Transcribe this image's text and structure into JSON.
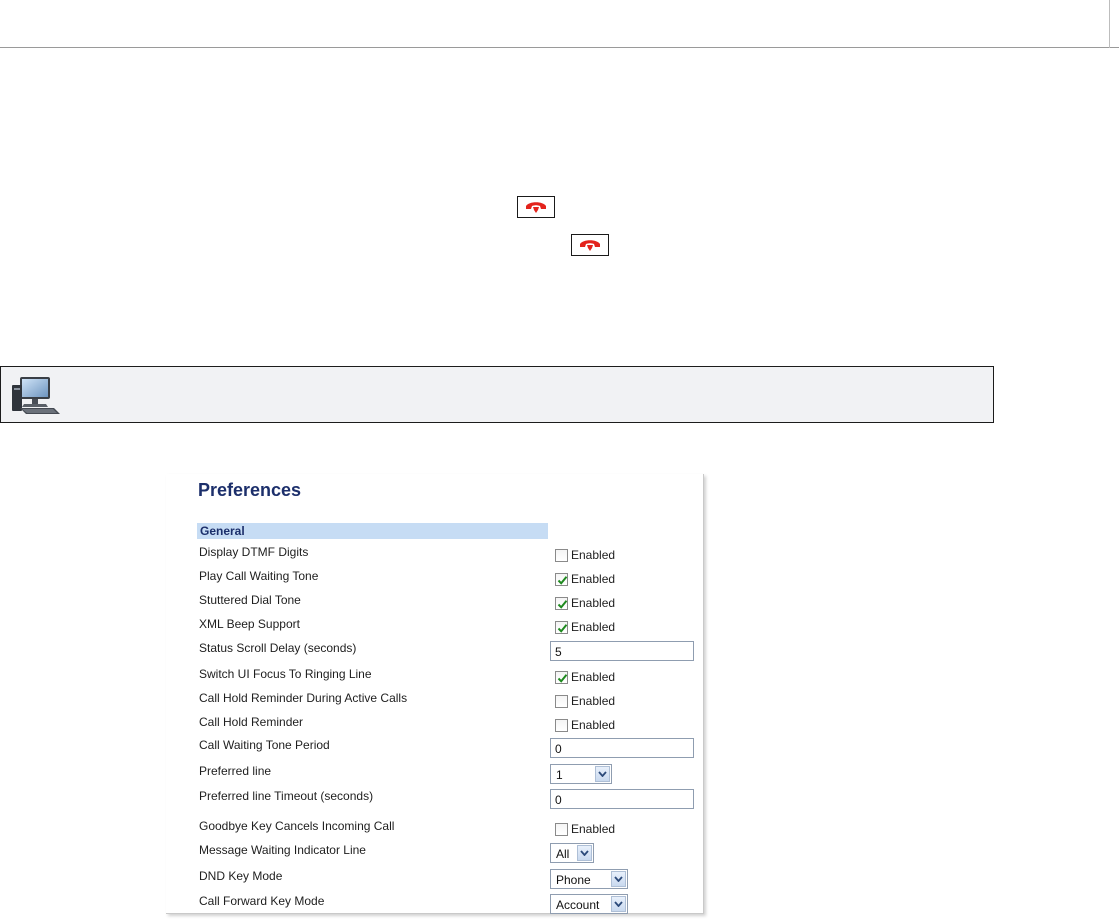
{
  "preferences": {
    "title": "Preferences",
    "section": "General",
    "enabled_label": "Enabled",
    "rows": {
      "display_dtmf": {
        "label": "Display DTMF Digits",
        "checked": false
      },
      "play_call_waiting_tone": {
        "label": "Play Call Waiting Tone",
        "checked": true
      },
      "stuttered_dial_tone": {
        "label": "Stuttered Dial Tone",
        "checked": true
      },
      "xml_beep_support": {
        "label": "XML Beep Support",
        "checked": true
      },
      "status_scroll_delay": {
        "label": "Status Scroll Delay (seconds)",
        "value": "5"
      },
      "switch_ui_focus": {
        "label": "Switch UI Focus To Ringing Line",
        "checked": true
      },
      "call_hold_reminder_active": {
        "label": "Call Hold Reminder During Active Calls",
        "checked": false
      },
      "call_hold_reminder": {
        "label": "Call Hold Reminder",
        "checked": false
      },
      "call_waiting_tone_period": {
        "label": "Call Waiting Tone Period",
        "value": "0"
      },
      "preferred_line": {
        "label": "Preferred line",
        "value": "1"
      },
      "preferred_line_timeout": {
        "label": "Preferred line Timeout (seconds)",
        "value": "0"
      },
      "goodbye_key_cancels": {
        "label": "Goodbye Key Cancels Incoming Call",
        "checked": false
      },
      "mwi_line": {
        "label": "Message Waiting Indicator Line",
        "value": "All"
      },
      "dnd_key_mode": {
        "label": "DND Key Mode",
        "value": "Phone"
      },
      "call_forward_key_mode": {
        "label": "Call Forward Key Mode",
        "value": "Account"
      }
    }
  },
  "icons": {
    "goodbye_key": "hang-up-handset-icon",
    "note": "computer-icon",
    "check": "checkmark-icon",
    "dropdown": "chevron-down-icon"
  },
  "colors": {
    "handset_red": "#e3231c",
    "title_navy": "#1c2f6b",
    "section_bg": "#c6dcf4",
    "check_green": "#1f8a1f"
  }
}
